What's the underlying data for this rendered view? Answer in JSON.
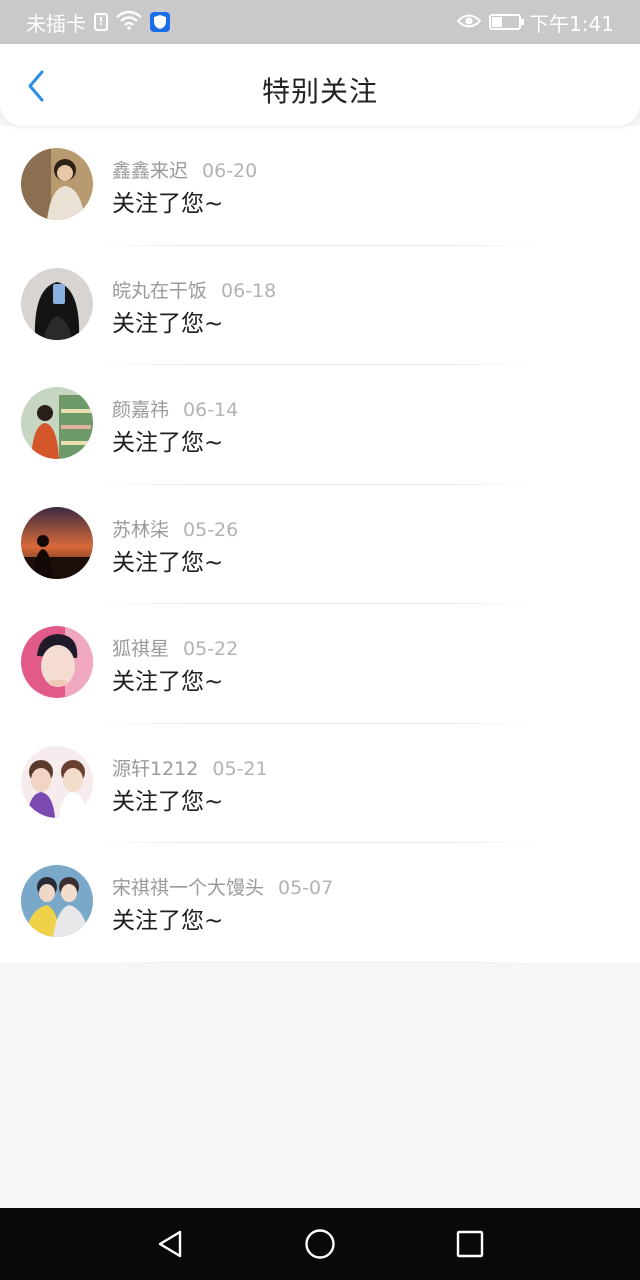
{
  "status_bar": {
    "carrier": "未插卡",
    "sim_badge": "!",
    "time": "下午1:41",
    "battery_level": 0.35
  },
  "header": {
    "title": "特别关注",
    "back_icon": "chevron-left-icon",
    "accent": "#2a8ee8"
  },
  "notifications": [
    {
      "name": "鑫鑫来迟",
      "date": "06-20",
      "message": "关注了您~"
    },
    {
      "name": "皖丸在干饭",
      "date": "06-18",
      "message": "关注了您~"
    },
    {
      "name": "颜嘉祎",
      "date": "06-14",
      "message": "关注了您~"
    },
    {
      "name": "苏林柒",
      "date": "05-26",
      "message": "关注了您~"
    },
    {
      "name": "狐祺星",
      "date": "05-22",
      "message": "关注了您~"
    },
    {
      "name": "源轩1212",
      "date": "05-21",
      "message": "关注了您~"
    },
    {
      "name": "宋祺祺一个大馒头",
      "date": "05-07",
      "message": "关注了您~"
    }
  ],
  "nav_bar": {
    "back": "triangle-back-icon",
    "home": "circle-home-icon",
    "recents": "square-recents-icon"
  }
}
